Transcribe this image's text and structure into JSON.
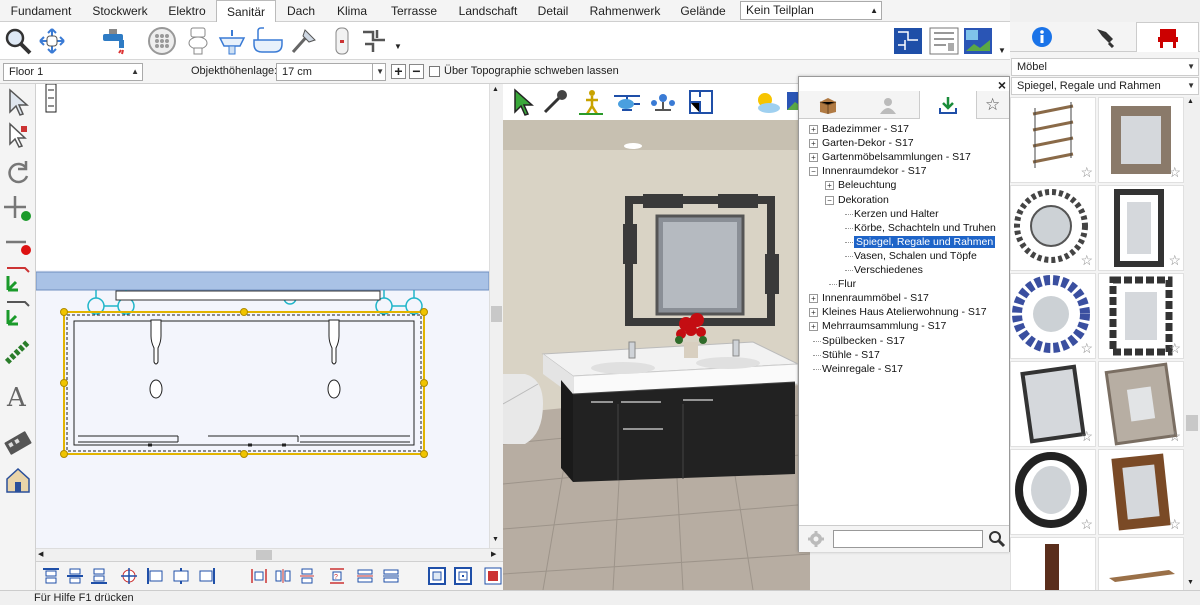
{
  "tabs": [
    "Fundament",
    "Stockwerk",
    "Elektro",
    "Sanitär",
    "Dach",
    "Klima",
    "Terrasse",
    "Landschaft",
    "Detail",
    "Rahmenwerk",
    "Gelände"
  ],
  "active_tab": "Sanitär",
  "teilplan": "Kein Teilplan",
  "options": {
    "floor": "Floor 1",
    "height_label": "Objekthöhenlage:",
    "height_value": "17 cm",
    "topo_label": "Über Topographie schweben lassen"
  },
  "right_panel": {
    "category": "Möbel",
    "subcategory": "Spiegel, Regale und Rahmen"
  },
  "catalog": {
    "close": "×",
    "tree": [
      {
        "label": "Badezimmer - S17",
        "level": 0,
        "expander": "+"
      },
      {
        "label": "Garten-Dekor - S17",
        "level": 0,
        "expander": "+"
      },
      {
        "label": "Gartenmöbelsammlungen - S17",
        "level": 0,
        "expander": "+"
      },
      {
        "label": "Innenraumdekor - S17",
        "level": 0,
        "expander": "-"
      },
      {
        "label": "Beleuchtung",
        "level": 1,
        "expander": "+"
      },
      {
        "label": "Dekoration",
        "level": 1,
        "expander": "-"
      },
      {
        "label": "Kerzen und Halter",
        "level": 2,
        "expander": ""
      },
      {
        "label": "Körbe, Schachteln und Truhen",
        "level": 2,
        "expander": ""
      },
      {
        "label": "Spiegel, Regale und Rahmen",
        "level": 2,
        "expander": "",
        "selected": true
      },
      {
        "label": "Vasen, Schalen und Töpfe",
        "level": 2,
        "expander": ""
      },
      {
        "label": "Verschiedenes",
        "level": 2,
        "expander": ""
      },
      {
        "label": "Flur",
        "level": 1,
        "expander": ""
      },
      {
        "label": "Innenraummöbel - S17",
        "level": 0,
        "expander": "+"
      },
      {
        "label": "Kleines Haus Atelierwohnung - S17",
        "level": 0,
        "expander": "+"
      },
      {
        "label": "Mehrraumsammlung - S17",
        "level": 0,
        "expander": "+"
      },
      {
        "label": "Spülbecken - S17",
        "level": 0,
        "expander": ""
      },
      {
        "label": "Stühle - S17",
        "level": 0,
        "expander": ""
      },
      {
        "label": "Weinregale - S17",
        "level": 0,
        "expander": ""
      }
    ],
    "search_placeholder": ""
  },
  "status": "Für Hilfe F1 drücken",
  "colors": {
    "selection": "#1e64c8",
    "accent_red": "#cc0000",
    "info_blue": "#1a73e8"
  }
}
